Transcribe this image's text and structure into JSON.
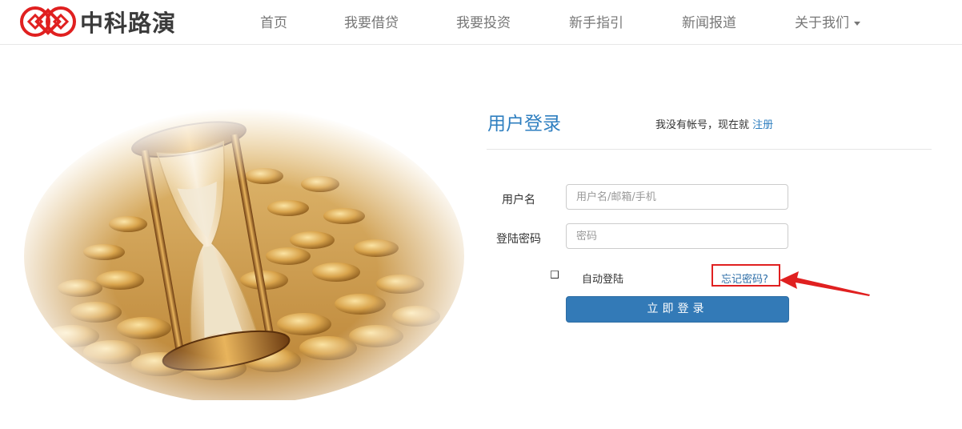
{
  "brand": {
    "name": "中科路演",
    "color": "#e02020",
    "icon": "logo-diamond-icon"
  },
  "nav": {
    "items": [
      {
        "label": "首页"
      },
      {
        "label": "我要借贷"
      },
      {
        "label": "我要投资"
      },
      {
        "label": "新手指引"
      },
      {
        "label": "新闻报道"
      },
      {
        "label": "关于我们",
        "has_dropdown": true
      }
    ]
  },
  "login": {
    "title": "用户登录",
    "register_prompt": "我没有帐号，现在就",
    "register_link": "注册",
    "username": {
      "label": "用户名",
      "value": "",
      "placeholder": "用户名/邮箱/手机"
    },
    "password": {
      "label": "登陆密码",
      "value": "",
      "placeholder": "密码"
    },
    "auto_login": {
      "label": "自动登陆",
      "checked": false
    },
    "forgot_password": "忘记密码?",
    "submit_label": "立即登录"
  },
  "colors": {
    "accent": "#337ab7",
    "title": "#2f7fc0",
    "highlight": "#e02020"
  },
  "hero": {
    "icon": "hourglass-coins-image"
  }
}
